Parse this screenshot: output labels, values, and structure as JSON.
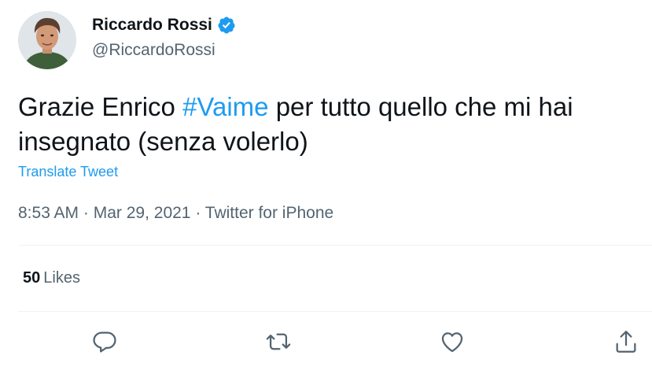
{
  "author": {
    "display_name": "Riccardo Rossi",
    "handle": "@RiccardoRossi",
    "verified": true,
    "avatar_icon": "profile-photo"
  },
  "tweet": {
    "text_before": "Grazie Enrico ",
    "hashtag": "#Vaime",
    "text_after": " per tutto quello che mi hai insegnato (senza volerlo)",
    "translate_label": "Translate Tweet",
    "time": "8:53 AM",
    "sep1": " · ",
    "date": "Mar 29, 2021",
    "sep2": " · ",
    "source": "Twitter for iPhone"
  },
  "stats": {
    "likes_count": "50",
    "likes_label": "Likes"
  },
  "actions": [
    {
      "icon": "reply-icon"
    },
    {
      "icon": "retweet-icon"
    },
    {
      "icon": "like-icon"
    },
    {
      "icon": "share-icon"
    }
  ],
  "colors": {
    "accent": "#1d9bf0",
    "text_primary": "#0f1419",
    "text_secondary": "#536471",
    "divider": "#eff3f4"
  }
}
